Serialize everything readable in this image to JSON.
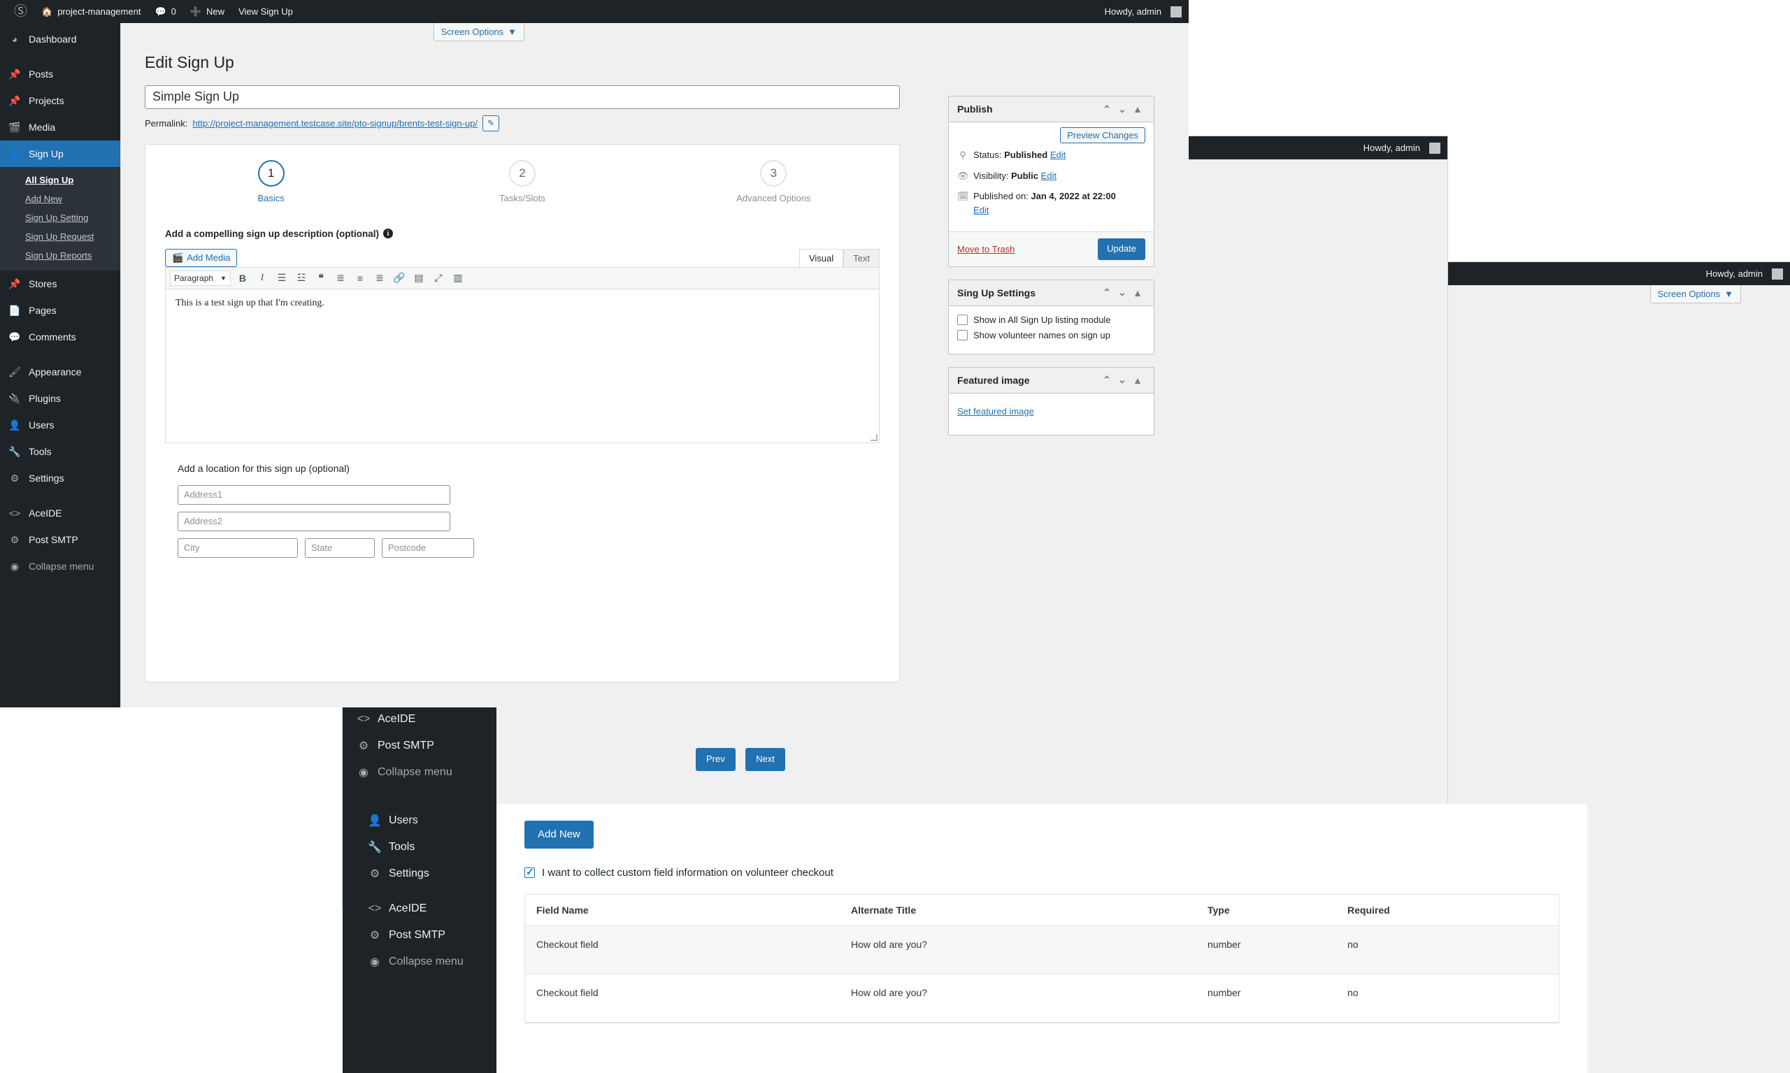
{
  "adminbar": {
    "logo_icon": "wordpress-logo-icon",
    "site_icon": "home-icon",
    "site_name": "project-management",
    "comments_icon": "comment-bubble-icon",
    "comments_count": "0",
    "new_icon": "plus-icon",
    "new_label": "New",
    "view_label": "View Sign Up",
    "howdy": "Howdy, admin"
  },
  "sidebar": {
    "items": [
      {
        "label": "Dashboard",
        "icon": "dashboard-icon"
      },
      {
        "label": "Posts",
        "icon": "pin-icon"
      },
      {
        "label": "Projects",
        "icon": "pin-icon"
      },
      {
        "label": "Media",
        "icon": "media-icon"
      },
      {
        "label": "Sign Up",
        "icon": "signup-person-icon",
        "current": true
      }
    ],
    "submenu": [
      {
        "label": "All Sign Up",
        "current": true
      },
      {
        "label": "Add New"
      },
      {
        "label": "Sign Up Setting"
      },
      {
        "label": "Sign Up Request"
      },
      {
        "label": "Sign Up Reports"
      }
    ],
    "group2": [
      {
        "label": "Stores",
        "icon": "pin-icon"
      },
      {
        "label": "Pages",
        "icon": "pages-icon"
      },
      {
        "label": "Comments",
        "icon": "comment-bubble-icon"
      }
    ],
    "group3": [
      {
        "label": "Appearance",
        "icon": "brush-icon"
      },
      {
        "label": "Plugins",
        "icon": "plug-icon"
      },
      {
        "label": "Users",
        "icon": "user-icon"
      },
      {
        "label": "Tools",
        "icon": "wrench-icon"
      },
      {
        "label": "Settings",
        "icon": "settings-sliders-icon"
      }
    ],
    "group4": [
      {
        "label": "AceIDE",
        "icon": "code-brackets-icon"
      },
      {
        "label": "Post SMTP",
        "icon": "gear-icon"
      },
      {
        "label": "Collapse menu",
        "icon": "collapse-arrow-icon"
      }
    ]
  },
  "screen_options_label": "Screen Options",
  "page": {
    "title": "Edit Sign Up",
    "title_input_value": "Simple Sign Up",
    "permalink_label": "Permalink:",
    "permalink_url": "http://project-management.testcase.site/pto-signup/brents-test-sign-up/",
    "edit_slug_icon": "pencil-square-icon"
  },
  "stepper": {
    "steps": [
      {
        "number": "1",
        "label": "Basics",
        "active": true
      },
      {
        "number": "2",
        "label": "Tasks/Slots",
        "active": false
      },
      {
        "number": "3",
        "label": "Advanced Options",
        "active": false
      }
    ]
  },
  "description": {
    "label": "Add a compelling sign up description (optional)",
    "info_icon": "info-circle-icon",
    "add_media_label": "Add Media",
    "add_media_icon": "media-icon",
    "tabs": [
      {
        "label": "Visual",
        "active": true
      },
      {
        "label": "Text",
        "active": false
      }
    ],
    "format_select_value": "Paragraph",
    "toolbar_icons": [
      "bold-icon",
      "italic-icon",
      "bulleted-list-icon",
      "numbered-list-icon",
      "blockquote-icon",
      "align-left-icon",
      "align-center-icon",
      "align-right-icon",
      "link-icon",
      "read-more-icon",
      "fullscreen-icon",
      "toolbar-toggle-icon"
    ],
    "body_text": "This is a test sign up that I'm creating."
  },
  "location": {
    "label": "Add a location for this sign up (optional)",
    "address1_placeholder": "Address1",
    "address2_placeholder": "Address2",
    "city_placeholder": "City",
    "state_placeholder": "State",
    "postcode_placeholder": "Postcode"
  },
  "wizard_nav": {
    "prev_label": "Prev",
    "next_label": "Next"
  },
  "publish": {
    "title": "Publish",
    "preview_label": "Preview Changes",
    "status_icon": "pin-key-icon",
    "status_label": "Status:",
    "status_value": "Published",
    "status_edit": "Edit",
    "visibility_icon": "eye-icon",
    "visibility_label": "Visibility:",
    "visibility_value": "Public",
    "visibility_edit": "Edit",
    "date_icon": "calendar-icon",
    "date_label": "Published on:",
    "date_value": "Jan 4, 2022 at 22:00",
    "date_edit": "Edit",
    "trash_label": "Move to Trash",
    "update_label": "Update",
    "collapse_up_icon": "chevron-up-icon",
    "collapse_down_icon": "chevron-down-icon",
    "toggle_icon": "caret-up-icon"
  },
  "signup_settings": {
    "title": "Sing Up Settings",
    "options": [
      {
        "label": "Show in All Sign Up listing module",
        "checked": false
      },
      {
        "label": "Show volunteer names on sign up",
        "checked": false
      }
    ]
  },
  "featured_image": {
    "title": "Featured image",
    "link_label": "Set featured image"
  },
  "custom_fields": {
    "add_new_label": "Add New",
    "collect_checkbox_label": "I want to collect custom field information on volunteer checkout",
    "collect_checked": true,
    "columns": [
      "Field Name",
      "Alternate Title",
      "Type",
      "Required"
    ],
    "rows": [
      {
        "field_name": "Checkout field",
        "alternate_title": "How old are you?",
        "type": "number",
        "required": "no"
      },
      {
        "field_name": "Checkout field",
        "alternate_title": "How old are you?",
        "type": "number",
        "required": "no"
      }
    ]
  },
  "colors": {
    "accent": "#2271b1",
    "admin_bg": "#1d2327",
    "submenu_bg": "#2c3338",
    "page_bg": "#f0f0f1",
    "trash_red": "#b32d2e"
  }
}
